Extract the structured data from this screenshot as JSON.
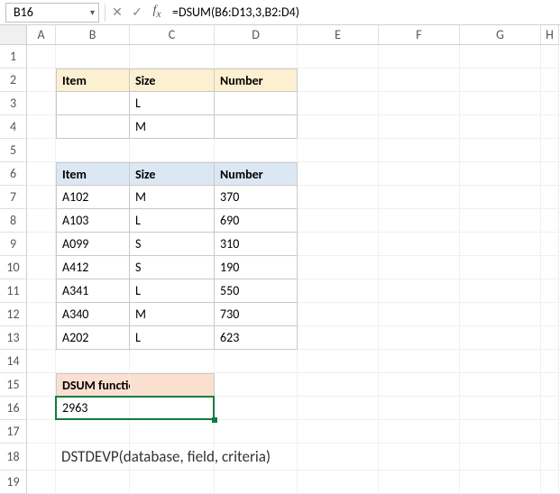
{
  "nameBox": "B16",
  "formula": "=DSUM(B6:D13,3,B2:D4)",
  "cols": [
    "A",
    "B",
    "C",
    "D",
    "E",
    "F",
    "G",
    "H"
  ],
  "rows": [
    "1",
    "2",
    "3",
    "4",
    "5",
    "6",
    "7",
    "8",
    "9",
    "10",
    "11",
    "12",
    "13",
    "14",
    "15",
    "16",
    "17",
    "18",
    "19"
  ],
  "criteria": {
    "headers": {
      "item": "Item",
      "size": "Size",
      "number": "Number"
    },
    "r3size": "L",
    "r4size": "M"
  },
  "db": {
    "headers": {
      "item": "Item",
      "size": "Size",
      "number": "Number"
    },
    "rows": [
      {
        "item": "A102",
        "size": "M",
        "number": "370"
      },
      {
        "item": "A103",
        "size": "L",
        "number": "690"
      },
      {
        "item": "A099",
        "size": "S",
        "number": "310"
      },
      {
        "item": "A412",
        "size": "S",
        "number": "190"
      },
      {
        "item": "A341",
        "size": "L",
        "number": "550"
      },
      {
        "item": "A340",
        "size": "M",
        "number": "730"
      },
      {
        "item": "A202",
        "size": "L",
        "number": "623"
      }
    ]
  },
  "resultLabel": "DSUM function",
  "resultValue": "2963",
  "syntax": "DSTDEVP(database, field, criteria)",
  "chart_data": {
    "type": "table",
    "title": "DSUM function",
    "criteria_table": {
      "columns": [
        "Item",
        "Size",
        "Number"
      ],
      "rows": [
        [
          "",
          "L",
          ""
        ],
        [
          "",
          "M",
          ""
        ]
      ]
    },
    "database_table": {
      "columns": [
        "Item",
        "Size",
        "Number"
      ],
      "rows": [
        [
          "A102",
          "M",
          370
        ],
        [
          "A103",
          "L",
          690
        ],
        [
          "A099",
          "S",
          310
        ],
        [
          "A412",
          "S",
          190
        ],
        [
          "A341",
          "L",
          550
        ],
        [
          "A340",
          "M",
          730
        ],
        [
          "A202",
          "L",
          623
        ]
      ]
    },
    "formula": "=DSUM(B6:D13,3,B2:D4)",
    "result": 2963
  }
}
